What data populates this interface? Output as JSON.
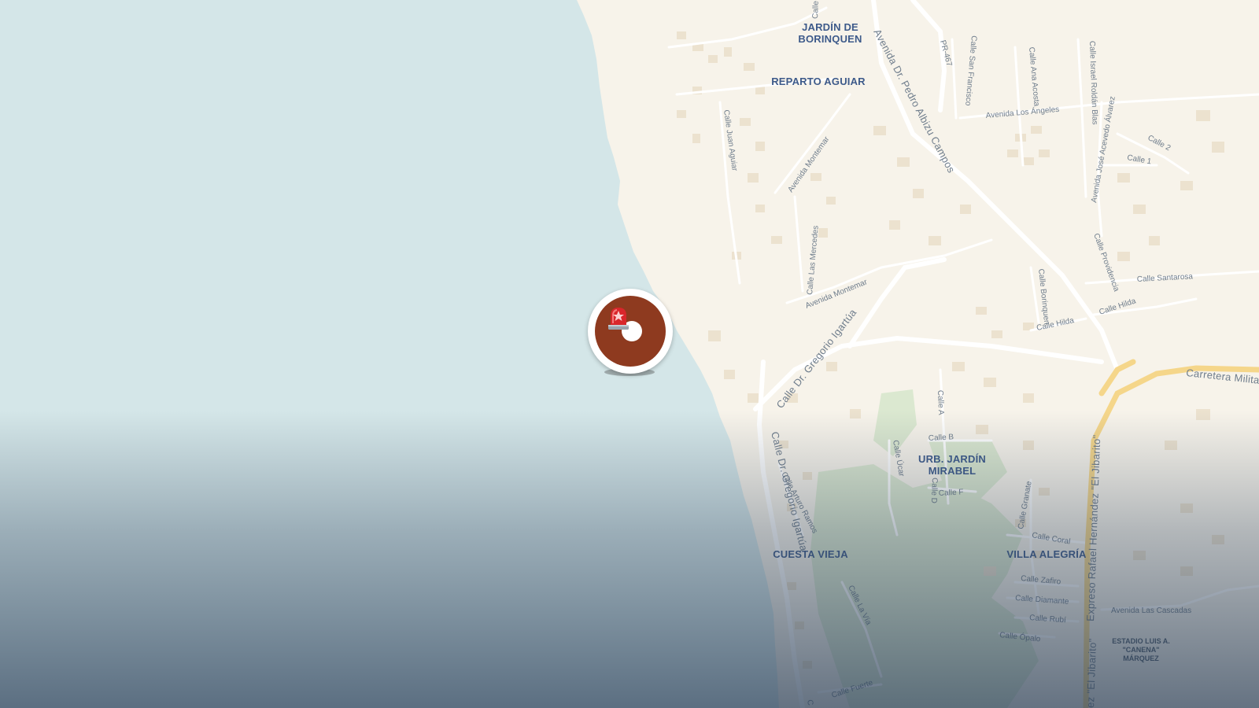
{
  "map": {
    "neighborhoods": [
      {
        "id": "jardin-borinquen",
        "label": "JARDÍN DE\nBORINQUEN"
      },
      {
        "id": "reparto-aguiar",
        "label": "REPARTO AGUIAR"
      },
      {
        "id": "urb-jardin-mirabel",
        "label": "URB. JARDÍN\nMIRABEL"
      },
      {
        "id": "cuesta-vieja",
        "label": "CUESTA VIEJA"
      },
      {
        "id": "villa-alegria",
        "label": "VILLA ALEGRÍA"
      }
    ],
    "landmark": {
      "label": "ESTADIO LUIS A.\n\"CANENA\"\nMÁRQUEZ"
    },
    "roads": {
      "pedro_albizu": "Avenida Dr. Pedro Albizu Campos",
      "pr467": "PR-467",
      "san_francisco": "Calle San Francisco",
      "ana_acosta": "Calle Ana Acosta",
      "isabel_roldan": "Calle Israel Roldán Blas",
      "jose_acevedo": "Avenida José Acevedo Álvarez",
      "los_angeles": "Avenida Los Ángeles",
      "calle2": "Calle 2",
      "calle1": "Calle 1",
      "juan_aguiar": "Calle Juan Aguiar",
      "montemar1": "Avenida Montemar",
      "montemar2": "Avenida Montemar",
      "las_mercedes": "Calle Las Mercedes",
      "providencia": "Calle Providencia",
      "santarosa": "Calle Santarosa",
      "hilda1": "Calle Hilda",
      "hilda2": "Calle Hilda",
      "borinquen": "Calle Borinquen",
      "gregorio1": "Calle Dr. Gregorio Igartúa",
      "gregorio2": "Calle Dr. Gregorio Igartúa",
      "carretera": "Carretera Milita",
      "calle_a": "Calle A",
      "calle_b": "Calle B",
      "ucar": "Calle Úcar",
      "calle_d": "Calle D",
      "calle_f": "Calle F",
      "arturo_ramos": "Calle Arturo Ramos",
      "granate": "Calle Granate",
      "coral": "Calle Coral",
      "zafiro": "Calle Zafiro",
      "diamante": "Calle Diamante",
      "rubi": "Calle Rubí",
      "opalo": "Calle Ópalo",
      "la_via": "Calle La Vía",
      "fuerte": "Calle Fuerte",
      "cascadas": "Avenida Las Cascadas",
      "expreso": "Expreso Rafael Hernández \"El Jibarito\"",
      "expreso_bottom": "ez \"El Jibarito\"",
      "calle_top": "Calle",
      "c_bottom": "C"
    },
    "marker": {
      "icon": "police-siren-icon",
      "color": "#8e3a1f"
    },
    "colors": {
      "water": "#d4e6e8",
      "land": "#f7f3ea",
      "park": "#dbe8d0",
      "highway": "#f5d68a",
      "road": "#ffffff"
    }
  }
}
